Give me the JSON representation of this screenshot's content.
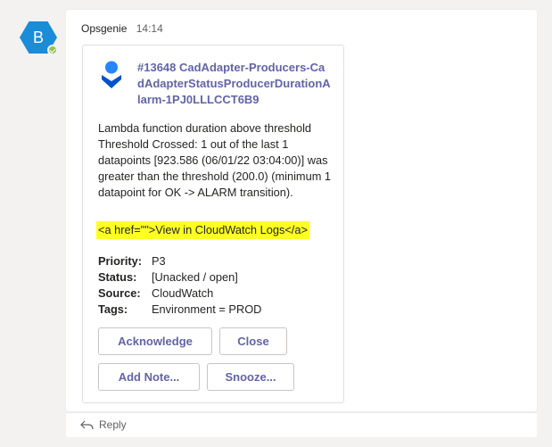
{
  "avatar": {
    "initial": "B",
    "color": "#1a8cd8",
    "presence": "available"
  },
  "message": {
    "sender": "Opsgenie",
    "timestamp": "14:14"
  },
  "card": {
    "logo_icon": "opsgenie-logo",
    "title": "#13648 CadAdapter-Producers-CadAdapterStatusProducerDurationAlarm-1PJ0LLLCCT6B9",
    "description": "Lambda function duration above threshold Threshold Crossed: 1 out of the last 1 datapoints [923.586 (06/01/22 03:04:00)] was greater than the threshold (200.0) (minimum 1 datapoint for OK -> ALARM transition).",
    "link_text": "<a href=\"\">View in CloudWatch Logs</a>",
    "link_highlight_color": "#ffff24",
    "accent_color": "#6264a7",
    "facts": [
      {
        "key": "Priority:",
        "value": "P3"
      },
      {
        "key": "Status:",
        "value": "[Unacked / open]"
      },
      {
        "key": "Source:",
        "value": "CloudWatch"
      },
      {
        "key": "Tags:",
        "value": "Environment = PROD"
      }
    ],
    "actions": {
      "acknowledge": "Acknowledge",
      "close": "Close",
      "add_note": "Add Note...",
      "snooze": "Snooze..."
    }
  },
  "reply": {
    "icon": "reply-arrow-icon",
    "label": "Reply"
  }
}
